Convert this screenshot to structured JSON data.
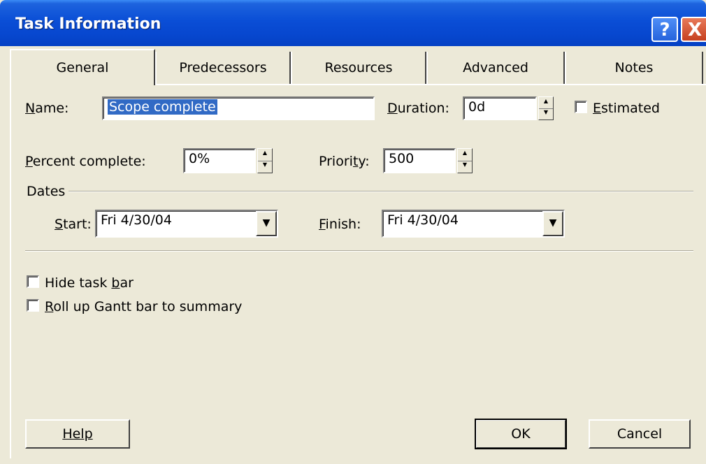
{
  "window": {
    "title": "Task Information",
    "help_glyph": "?",
    "close_glyph": "X"
  },
  "tabs": [
    {
      "label": "General",
      "active": true
    },
    {
      "label": "Predecessors",
      "active": false
    },
    {
      "label": "Resources",
      "active": false
    },
    {
      "label": "Advanced",
      "active": false
    },
    {
      "label": "Notes",
      "active": false
    }
  ],
  "general": {
    "name_label": "Name:",
    "name_value": "Scope complete",
    "duration_label": "Duration:",
    "duration_value": "0d",
    "estimated_label": "Estimated",
    "estimated_checked": false,
    "percent_label": "Percent complete:",
    "percent_value": "0%",
    "priority_label": "Priority:",
    "priority_value": "500",
    "dates_group_label": "Dates",
    "start_label": "Start:",
    "start_value": "Fri 4/30/04",
    "finish_label": "Finish:",
    "finish_value": "Fri 4/30/04",
    "hide_bar_label": "Hide task bar",
    "hide_bar_checked": false,
    "rollup_label": "Roll up Gantt bar to summary",
    "rollup_checked": false
  },
  "footer": {
    "help_label": "Help",
    "ok_label": "OK",
    "cancel_label": "Cancel"
  },
  "colors": {
    "title_bar": "#0a4ed6",
    "dialog_face": "#ece9d8",
    "selection": "#316ac5",
    "close_button": "#c6401f"
  }
}
